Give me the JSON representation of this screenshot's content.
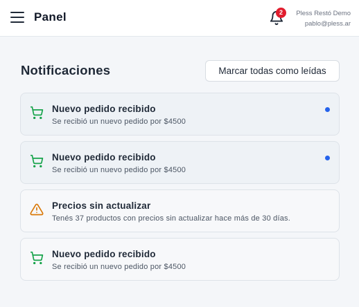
{
  "header": {
    "app_title": "Panel",
    "notification_count": "2",
    "user_name": "Pless Restó Demo",
    "user_email": "pablo@pless.ar"
  },
  "main": {
    "title": "Notificaciones",
    "mark_all_label": "Marcar todas como leídas"
  },
  "notifications": [
    {
      "icon": "cart-icon",
      "title": "Nuevo pedido recibido",
      "description": "Se recibió un nuevo pedido por $4500",
      "unread": true
    },
    {
      "icon": "cart-icon",
      "title": "Nuevo pedido recibido",
      "description": "Se recibió un nuevo pedido por $4500",
      "unread": true
    },
    {
      "icon": "warning-icon",
      "title": "Precios sin actualizar",
      "description": "Tenés 37 productos con precios sin actualizar hace más de 30 días.",
      "unread": false
    },
    {
      "icon": "cart-icon",
      "title": "Nuevo pedido recibido",
      "description": "Se recibió un nuevo pedido por $4500",
      "unread": false
    }
  ],
  "colors": {
    "accent_blue": "#2563eb",
    "badge_red": "#e11d2e",
    "cart_green": "#16a34a",
    "warning_orange": "#d97706"
  }
}
